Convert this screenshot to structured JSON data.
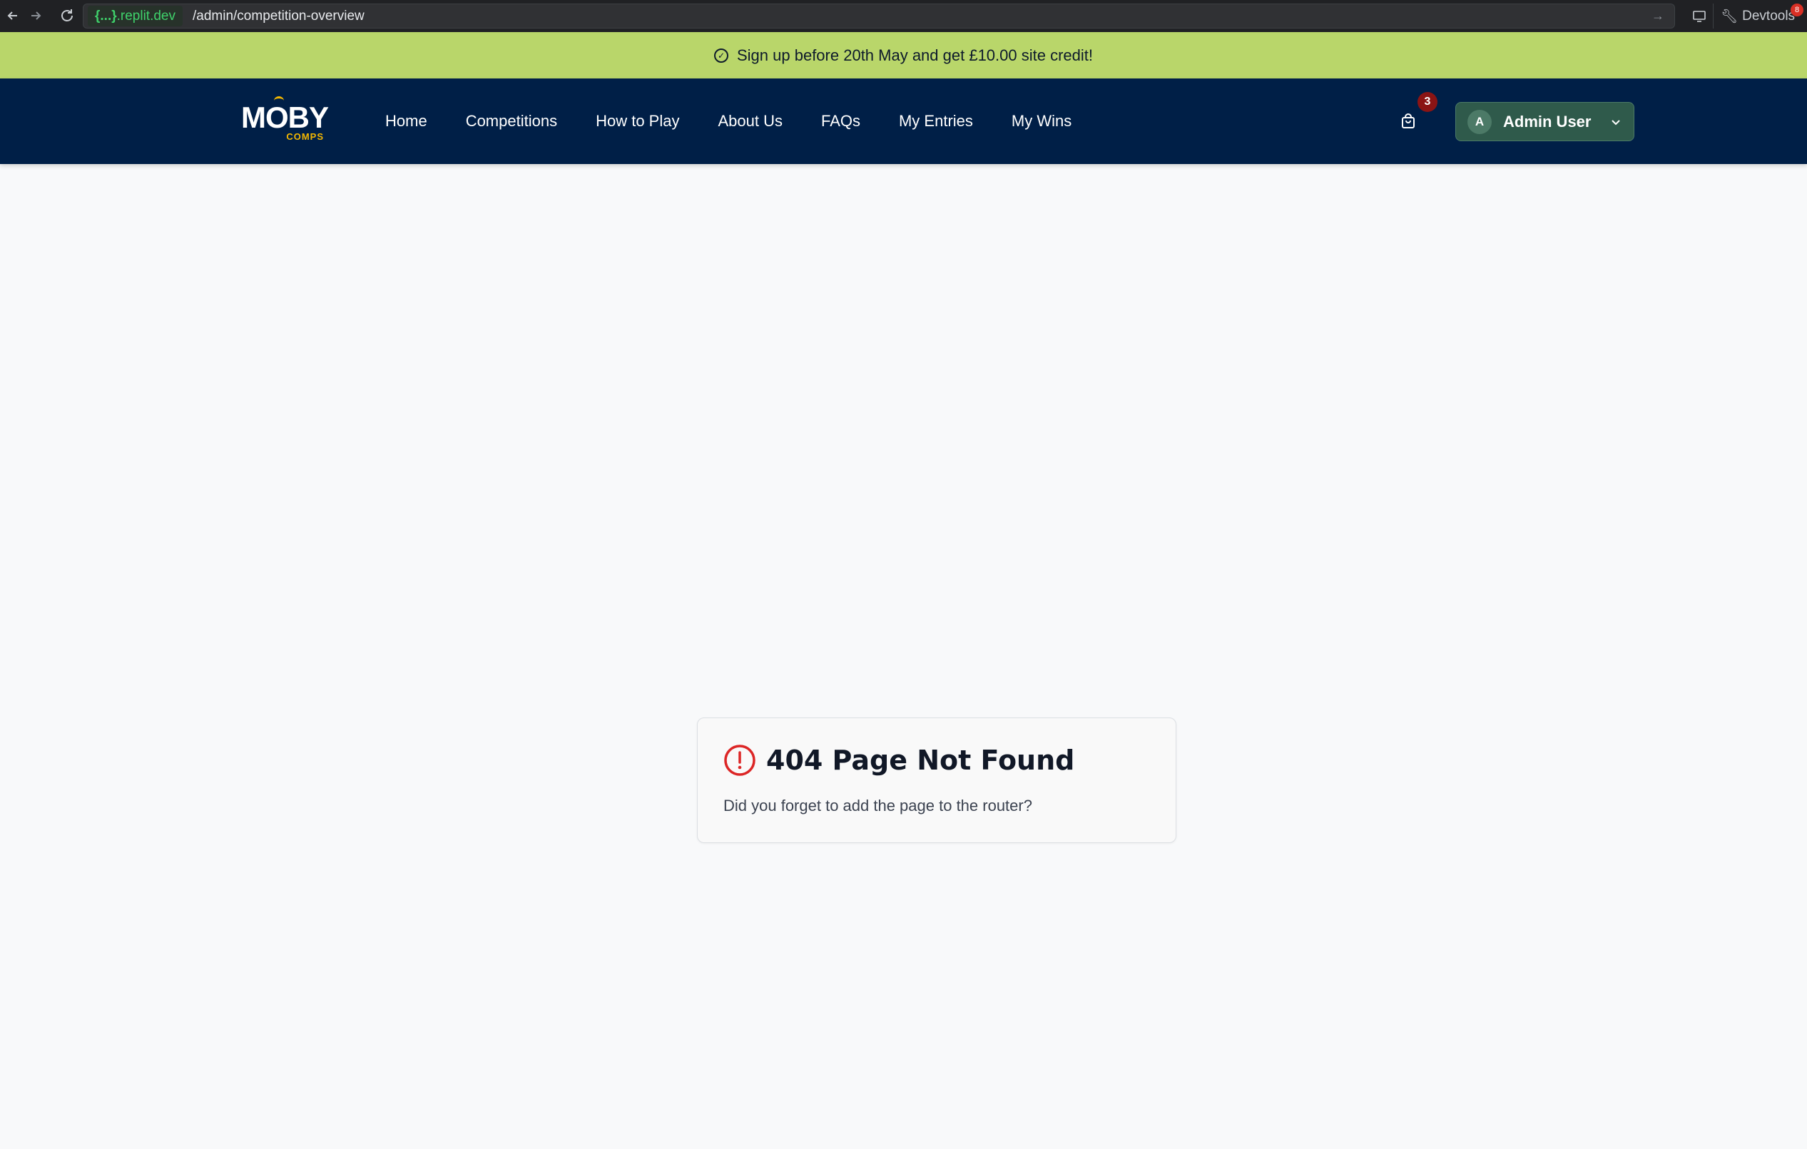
{
  "browser": {
    "back_icon": "arrow-left",
    "forward_icon": "arrow-right",
    "reload_icon": "reload",
    "url_host_brace": "{...}",
    "url_host": ".replit.dev",
    "url_path": "/admin/competition-overview",
    "devtools_label": "Devtools"
  },
  "promo": {
    "text": "Sign up before 20th May and get £10.00 site credit!"
  },
  "header": {
    "logo_main": "MOBY",
    "logo_sub": "COMPS",
    "nav": [
      {
        "label": "Home"
      },
      {
        "label": "Competitions"
      },
      {
        "label": "How to Play"
      },
      {
        "label": "About Us"
      },
      {
        "label": "FAQs"
      },
      {
        "label": "My Entries"
      },
      {
        "label": "My Wins"
      }
    ],
    "cart_count": "3",
    "user": {
      "initial": "A",
      "name": "Admin User"
    }
  },
  "error_card": {
    "title": "404 Page Not Found",
    "message": "Did you forget to add the page to the router?"
  },
  "colors": {
    "promo_bg": "#b9d66a",
    "header_bg": "#001f47",
    "user_menu_bg": "#2f5a4b",
    "cart_badge": "#8b1414",
    "error_red": "#dc2626"
  }
}
